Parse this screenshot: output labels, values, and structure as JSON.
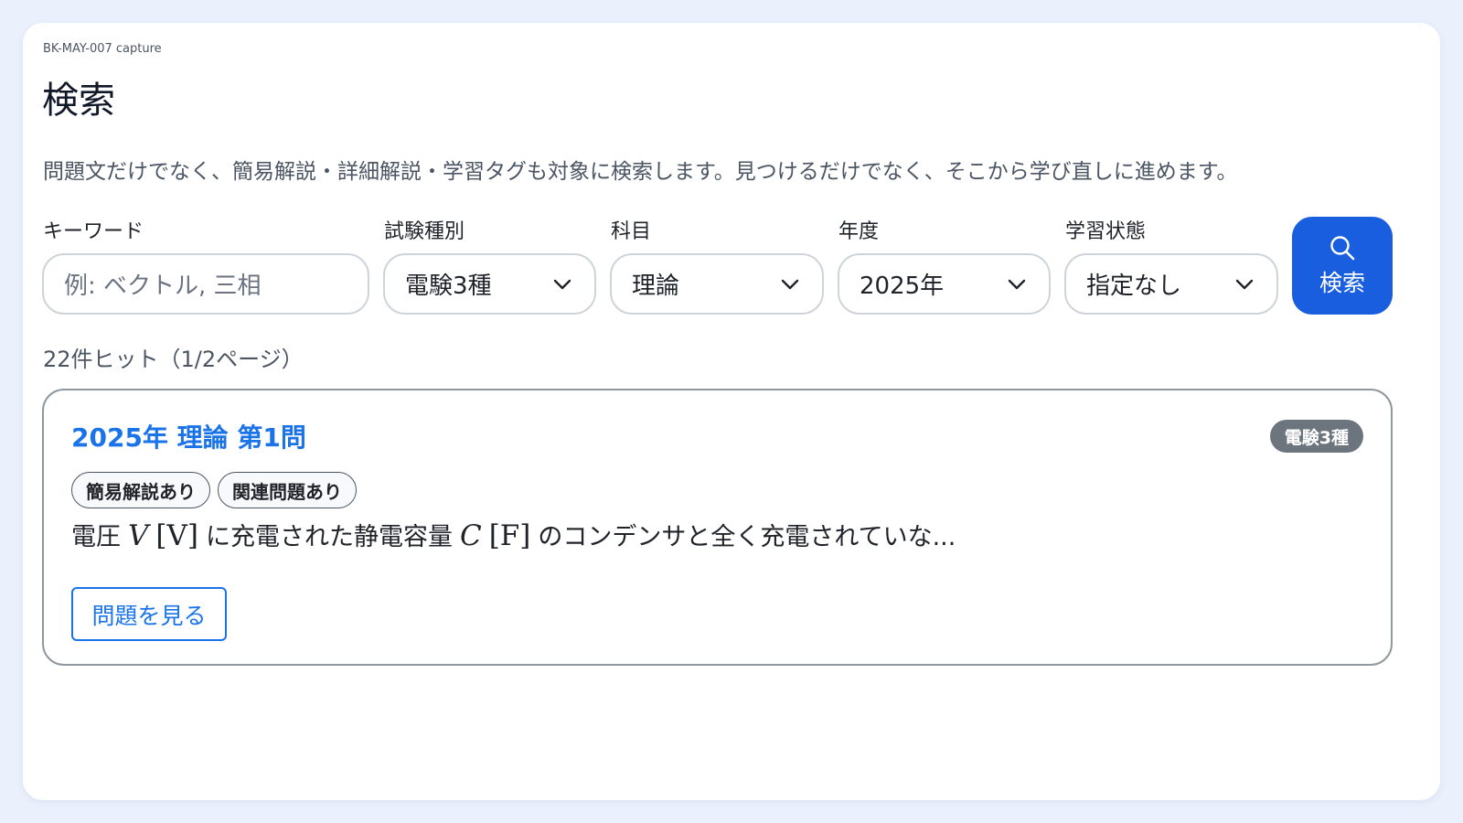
{
  "capture_label": "BK-MAY-007 capture",
  "page_title": "検索",
  "description": "問題文だけでなく、簡易解説・詳細解説・学習タグも対象に検索します。見つけるだけでなく、そこから学び直しに進めます。",
  "filters": {
    "keyword": {
      "label": "キーワード",
      "placeholder": "例: ベクトル, 三相",
      "value": ""
    },
    "exam_type": {
      "label": "試験種別",
      "value": "電験3種"
    },
    "subject": {
      "label": "科目",
      "value": "理論"
    },
    "year": {
      "label": "年度",
      "value": "2025年"
    },
    "study_status": {
      "label": "学習状態",
      "value": "指定なし"
    }
  },
  "search_button": {
    "label": "検索",
    "icon": "search-icon"
  },
  "result_count": "22件ヒット（1/2ページ）",
  "results": [
    {
      "title": "2025年 理論 第1問",
      "badge": "電験3種",
      "tags": [
        "簡易解説あり",
        "関連問題あり"
      ],
      "snippet": {
        "part1": "電圧",
        "var1": "V",
        "unit1": "[V]",
        "part2": "に充電された静電容量",
        "var2": "C",
        "unit2": "[F]",
        "part3": "のコンデンサと全く充電されていな..."
      },
      "view_label": "問題を見る"
    }
  ],
  "colors": {
    "accent": "#1a5ee0",
    "link": "#1a73e8",
    "badge": "#6c757d",
    "background": "#eaf1fd"
  }
}
